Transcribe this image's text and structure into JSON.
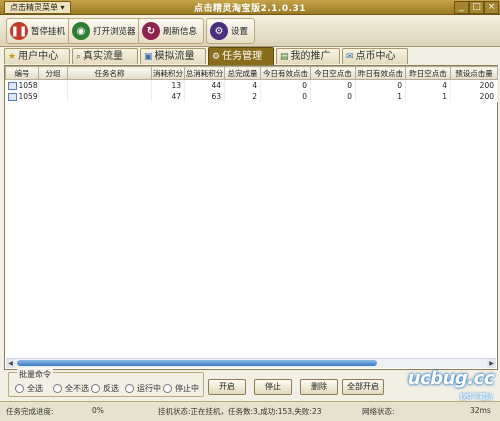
{
  "titlebar": {
    "menu_label": "点击精灵菜单 ▾",
    "title": "点击精灵淘宝版2.1.0.31",
    "controls": [
      "_",
      "□",
      "×"
    ]
  },
  "toolbar": {
    "buttons": [
      {
        "label": "暂停挂机",
        "icon": "pause-icon",
        "color": "#c0392b"
      },
      {
        "label": "打开浏览器",
        "icon": "browser-icon",
        "color": "#2e7d32"
      },
      {
        "label": "刷新信息",
        "icon": "refresh-icon",
        "color": "#8e244d"
      },
      {
        "label": "设置",
        "icon": "settings-icon",
        "color": "#4a2f7c"
      }
    ]
  },
  "tabs": [
    {
      "label": "用户中心",
      "icon": "star-icon"
    },
    {
      "label": "真实流量",
      "icon": "search-icon"
    },
    {
      "label": "模拟流量",
      "icon": "monitor-icon"
    },
    {
      "label": "任务管理",
      "icon": "gear-icon",
      "active": true
    },
    {
      "label": "我的推广",
      "icon": "image-icon"
    },
    {
      "label": "点币中心",
      "icon": "chat-icon"
    }
  ],
  "table": {
    "columns": [
      "编号",
      "分组",
      "任务名称",
      "消耗积分",
      "总消耗积分",
      "总完成量",
      "今日有效点击",
      "今日空点击",
      "昨日有效点击",
      "昨日空点击",
      "预设点击量"
    ],
    "rows": [
      [
        "1058...",
        "",
        "",
        "13",
        "44",
        "4",
        "0",
        "0",
        "0",
        "4",
        "200"
      ],
      [
        "1059...",
        "",
        "",
        "47",
        "63",
        "2",
        "0",
        "0",
        "1",
        "1",
        "200"
      ]
    ]
  },
  "batch": {
    "title": "批量命令",
    "options": [
      "全选",
      "全不选",
      "反选",
      "运行中",
      "停止中"
    ],
    "actions": [
      "开启",
      "停止",
      "删除",
      "全部开启"
    ]
  },
  "status": {
    "progress_label": "任务完成进度:",
    "progress_value": "0%",
    "hang_status": "挂机状态:正在挂机，任务数:3,成功:153,失败:23",
    "net_label": "网络状态:",
    "latency": "32ms"
  },
  "watermark": {
    "main": "ucbug.cc",
    "sub": "软件下载站"
  }
}
